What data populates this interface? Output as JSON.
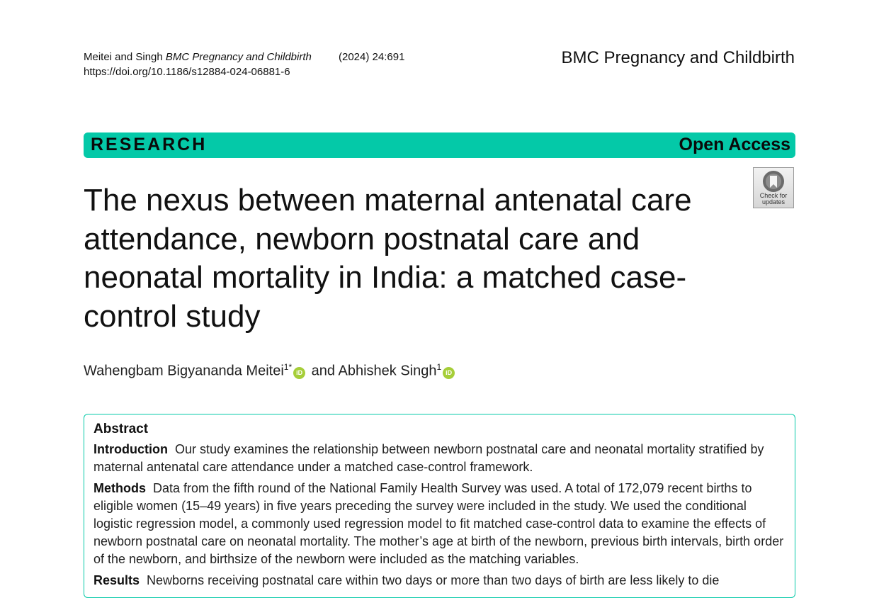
{
  "header": {
    "authors_short": "Meitei and Singh",
    "journal_italic": "BMC Pregnancy and Childbirth",
    "citation": "(2024) 24:691",
    "doi": "https://doi.org/10.1186/s12884-024-06881-6",
    "journal_name": "BMC Pregnancy and Childbirth"
  },
  "banner": {
    "type": "RESEARCH",
    "access": "Open Access",
    "color": "#04c9a8"
  },
  "check_updates": {
    "line1": "Check for",
    "line2": "updates"
  },
  "title": "The nexus between maternal antenatal care attendance, newborn postnatal care and neonatal mortality in India: a matched case-control study",
  "authors": {
    "author1": "Wahengbam Bigyananda Meitei",
    "author1_sup": "1*",
    "connector": "and",
    "author2": "Abhishek Singh",
    "author2_sup": "1",
    "orcid_icon": "iD"
  },
  "abstract": {
    "heading": "Abstract",
    "sections": [
      {
        "label": "Introduction",
        "text": "Our study examines the relationship between newborn postnatal care and neonatal mortality stratified by maternal antenatal care attendance under a matched case-control framework."
      },
      {
        "label": "Methods",
        "text": "Data from the fifth round of the National Family Health Survey was used. A total of 172,079 recent births to eligible women (15–49 years) in five years preceding the survey were included in the study. We used the conditional logistic regression model, a commonly used regression model to fit matched case-control data to examine the effects of newborn postnatal care on neonatal mortality. The mother’s age at birth of the newborn, previous birth intervals, birth order of the newborn, and birthsize of the newborn were included as the matching variables."
      },
      {
        "label": "Results",
        "text": "Newborns receiving postnatal care within two days or more than two days of birth are less likely to die"
      }
    ]
  }
}
